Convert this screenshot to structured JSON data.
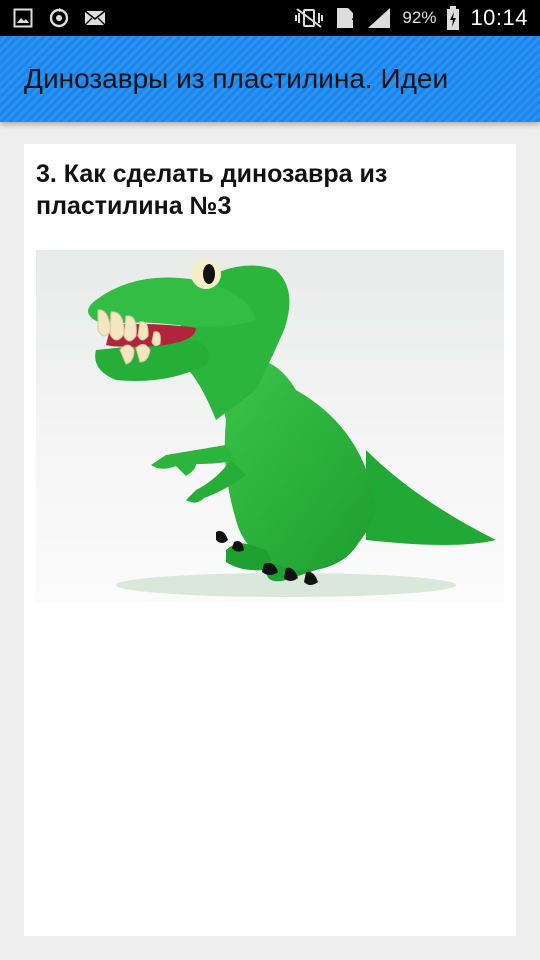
{
  "status_bar": {
    "battery_percent": "92%",
    "sim_slot": "1",
    "time": "10:14",
    "icons": [
      "gallery-icon",
      "sync-icon",
      "mail-icon",
      "vibrate-mute-icon",
      "sim-icon",
      "signal-icon",
      "battery-charging-icon"
    ]
  },
  "app_bar": {
    "title": "Динозавры из пластилина. Идеи",
    "color": "#1e88e5"
  },
  "article": {
    "title": "3. Как сделать динозавра из пластилина №3",
    "image": "green-plasticine-dinosaur"
  }
}
